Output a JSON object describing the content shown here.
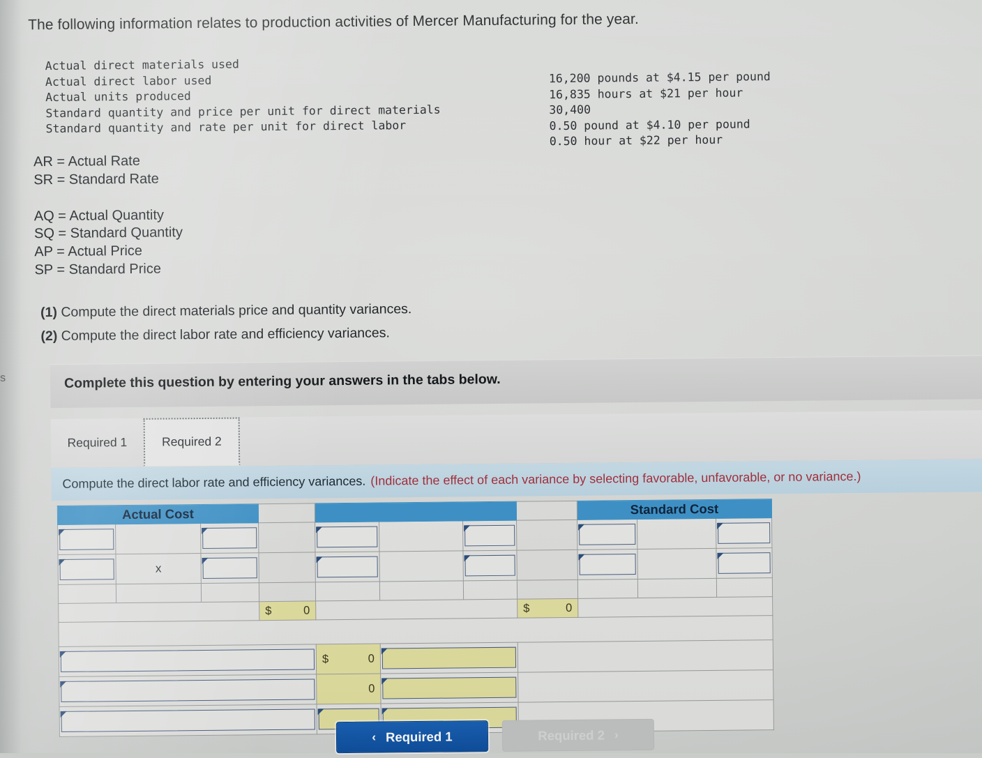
{
  "intro": {
    "paragraph": "The following information relates to production activities of Mercer Manufacturing for the year."
  },
  "data_block": {
    "labels": "Actual direct materials used\nActual direct labor used\nActual units produced\nStandard quantity and price per unit for direct materials\nStandard quantity and rate per unit for direct labor",
    "values": "16,200 pounds at $4.15 per pound\n16,835 hours at $21 per hour\n30,400\n0.50 pound at $4.10 per pound\n0.50 hour at $22 per hour",
    "label_lines": [
      "Actual direct materials used",
      "Actual direct labor used",
      "Actual units produced",
      "Standard quantity and price per unit for direct materials",
      "Standard quantity and rate per unit for direct labor"
    ],
    "value_lines": [
      "16,200 pounds at $4.15 per pound",
      "16,835 hours at $21 per hour",
      "30,400",
      "0.50 pound at $4.10 per pound",
      "0.50 hour at $22 per hour"
    ]
  },
  "legend": {
    "line1": "AR = Actual Rate",
    "line2": "SR = Standard Rate",
    "line3": "AQ = Actual Quantity",
    "line4": "SQ = Standard Quantity",
    "line5": "AP = Actual Price",
    "line6": "SP = Standard Price"
  },
  "requirements": {
    "num1": "(1)",
    "text1": "Compute the direct materials price and quantity variances.",
    "num2": "(2)",
    "text2": "Compute the direct labor rate and efficiency variances."
  },
  "edge_char": "s",
  "question_panel": {
    "title": "Complete this question by entering your answers in the tabs below."
  },
  "tabs": [
    {
      "label": "Required 1",
      "active": false
    },
    {
      "label": "Required 2",
      "active": true
    }
  ],
  "instruction": {
    "main": "Compute the direct labor rate and efficiency variances.",
    "note": "(Indicate the effect of each variance by selecting favorable, unfavorable, or no variance.)",
    "note_color": "#a3303c"
  },
  "worksheet": {
    "header_actual": "Actual Cost",
    "header_middle": "",
    "header_standard": "Standard Cost",
    "multiply_symbol": "x",
    "totals": {
      "actual_dollar": "$",
      "actual_value": "0",
      "standard_dollar": "$",
      "standard_value": "0"
    },
    "variance_rows": [
      {
        "label": "",
        "dollar": "$",
        "value": "0",
        "effect": ""
      },
      {
        "label": "",
        "dollar": "",
        "value": "0",
        "effect": ""
      },
      {
        "label": "",
        "dollar": "",
        "value": "",
        "effect": ""
      }
    ],
    "colors": {
      "header_blue": "#3f93c9",
      "input_yellow": "#e2dfa0",
      "input_border": "#4a5f80",
      "cell_gray": "#e3e4e2"
    }
  },
  "footer_nav": {
    "prev_label": "Required 1",
    "prev_chevron": "‹",
    "next_label": "Required 2",
    "next_chevron": "›",
    "next_disabled": true
  }
}
